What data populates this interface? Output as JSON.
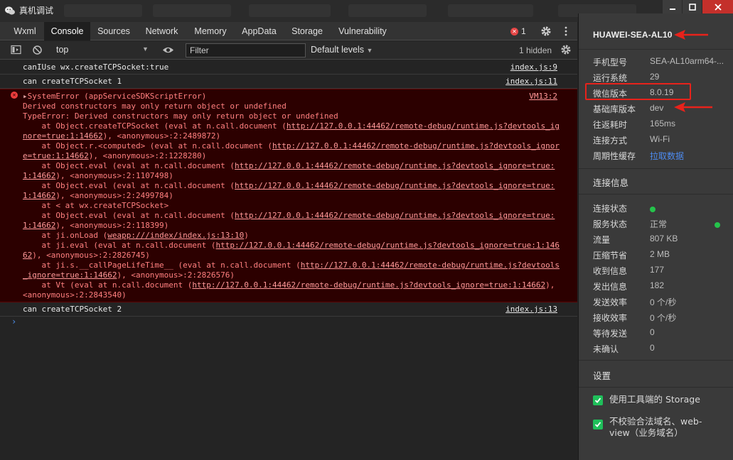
{
  "window": {
    "title": "真机调试",
    "controls": [
      "minimize",
      "maximize",
      "close"
    ]
  },
  "devtools": {
    "tabs": [
      {
        "label": "Wxml",
        "active": false
      },
      {
        "label": "Console",
        "active": true
      },
      {
        "label": "Sources",
        "active": false
      },
      {
        "label": "Network",
        "active": false
      },
      {
        "label": "Memory",
        "active": false
      },
      {
        "label": "AppData",
        "active": false
      },
      {
        "label": "Storage",
        "active": false
      },
      {
        "label": "Vulnerability",
        "active": false
      }
    ],
    "error_count": "1"
  },
  "toolbar": {
    "context": "top",
    "filter_placeholder": "Filter",
    "levels": "Default levels",
    "hidden": "1 hidden"
  },
  "console": {
    "log1": {
      "text": "canIUse wx.createTCPSocket:true",
      "source": "index.js:9"
    },
    "log2": {
      "text": "can createTCPSocket 1",
      "source": "index.js:11"
    },
    "error": {
      "source": "VM13:2",
      "header": "SystemError (appServiceSDKScriptError)",
      "line1": "Derived constructors may only return object or undefined",
      "line2": "TypeError: Derived constructors may only return object or undefined",
      "line3a": "    at Object.createTCPSocket (eval at n.call.document (",
      "line3link": "http://127.0.0.1:44462/remote-debug/runtime.js?devtools_ig",
      "line4": "nore=true:1:14662",
      "line4b": "), <anonymous>:2:2489872)",
      "line5a": "    at Object.r.<computed> (eval at n.call.document (",
      "line5link": "http://127.0.0.1:44462/remote-debug/runtime.js?devtools_ignor",
      "line6": "e=true:1:14662",
      "line6b": "), <anonymous>:2:1228280)",
      "line7a": "    at Object.eval (eval at n.call.document (",
      "line7link": "http://127.0.0.1:44462/remote-debug/runtime.js?devtools_ignore=true:",
      "line8": "1:14662",
      "line8b": "), <anonymous>:2:1107498)",
      "line9a": "    at Object.eval (eval at n.call.document (",
      "line9link": "http://127.0.0.1:44462/remote-debug/runtime.js?devtools_ignore=true:",
      "line10": "1:14662",
      "line10b": "), <anonymous>:2:2499784)",
      "line11": "    at < at wx.createTCPSocket>",
      "line12a": "    at Object.eval (eval at n.call.document (",
      "line12link": "http://127.0.0.1:44462/remote-debug/runtime.js?devtools_ignore=true:",
      "line13": "1:14662",
      "line13b": "), <anonymous>:2:118399)",
      "line14a": "    at ji.onLoad (",
      "line14link": "weapp:///index/index.js:13:10",
      "line14b": ")",
      "line15a": "    at ji.eval (eval at n.call.document (",
      "line15link": "http://127.0.0.1:44462/remote-debug/runtime.js?devtools_ignore=true:1:146",
      "line16": "62",
      "line16b": "), <anonymous>:2:2826745)",
      "line17a": "    at ji.s.__callPageLifeTime__ (eval at n.call.document (",
      "line17link": "http://127.0.0.1:44462/remote-debug/runtime.js?devtools",
      "line18": "_ignore=true:1:14662",
      "line18b": "), <anonymous>:2:2826576)",
      "line19a": "    at Vt (eval at n.call.document (",
      "line19link": "http://127.0.0.1:44462/remote-debug/runtime.js?devtools_ignore=true:1:14662",
      "line19b": "),",
      "line20": "<anonymous>:2:2843540)"
    },
    "log3": {
      "text": "can createTCPSocket 2",
      "source": "index.js:13"
    },
    "prompt": "›"
  },
  "sidebar": {
    "device": "HUAWEI-SEA-AL10",
    "info": [
      {
        "k": "手机型号",
        "v": "SEA-AL10arm64-..."
      },
      {
        "k": "运行系统",
        "v": "29"
      },
      {
        "k": "微信版本",
        "v": "8.0.19"
      },
      {
        "k": "基础库版本",
        "v": "dev"
      },
      {
        "k": "往返耗时",
        "v": "165ms"
      },
      {
        "k": "连接方式",
        "v": "Wi-Fi"
      },
      {
        "k": "周期性缓存",
        "v": "拉取数据"
      }
    ],
    "connection_title": "连接信息",
    "connection": [
      {
        "k": "连接状态",
        "v": ""
      },
      {
        "k": "服务状态",
        "v": "正常"
      },
      {
        "k": "流量",
        "v": "807 KB"
      },
      {
        "k": "压缩节省",
        "v": "2 MB"
      },
      {
        "k": "收到信息",
        "v": "177"
      },
      {
        "k": "发出信息",
        "v": "182"
      },
      {
        "k": "发送效率",
        "v": "0 个/秒"
      },
      {
        "k": "接收效率",
        "v": "0 个/秒"
      },
      {
        "k": "等待发送",
        "v": "0"
      },
      {
        "k": "未确认",
        "v": "0"
      }
    ],
    "settings_title": "设置",
    "settings": [
      {
        "label": "使用工具端的 Storage",
        "checked": true
      },
      {
        "label1": "不校验合法域名、web-",
        "label2": "view（业务域名）",
        "checked": true
      }
    ]
  },
  "colors": {
    "accent_green": "#1fbf5a",
    "error_red": "#ff8080",
    "annotation_red": "#e8221b",
    "link_blue": "#4d8bf0"
  }
}
